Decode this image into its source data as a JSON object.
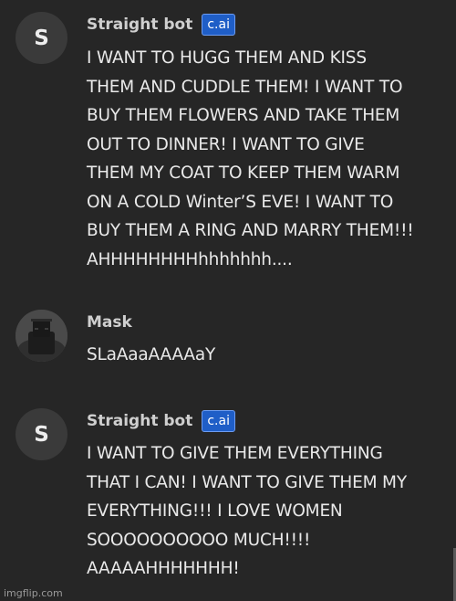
{
  "messages": [
    {
      "avatar_letter": "S",
      "name": "Straight bot",
      "badge": "c.ai",
      "text": "I WANT TO HUGG THEM AND KISS\nTHEM AND CUDDLE THEM! I WANT TO\nBUY THEM FLOWERS AND TAKE THEM\nOUT TO DINNER! I WANT TO GIVE\nTHEM MY COAT TO KEEP THEM WARM\nON A COLD Winter’S EVE! I WANT TO\nBUY THEM A RING AND MARRY THEM!!!\nAHHHHHHHHhhhhhhh...."
    },
    {
      "avatar_icon": "mask-avatar-icon",
      "name": "Mask",
      "text": "SLaAaaAAAAaY"
    },
    {
      "avatar_letter": "S",
      "name": "Straight bot",
      "badge": "c.ai",
      "text": "I WANT TO GIVE THEM EVERYTHING\nTHAT I CAN! I WANT TO GIVE THEM MY\nEVERYTHING!!! I LOVE WOMEN\nSOOOOOOOOOO MUCH!!!!\nAAAAAHHHHHHH!"
    }
  ],
  "watermark": "imgflip.com",
  "colors": {
    "background": "#262626",
    "badge": "#1f5ec7",
    "text": "#e9e9e9"
  }
}
